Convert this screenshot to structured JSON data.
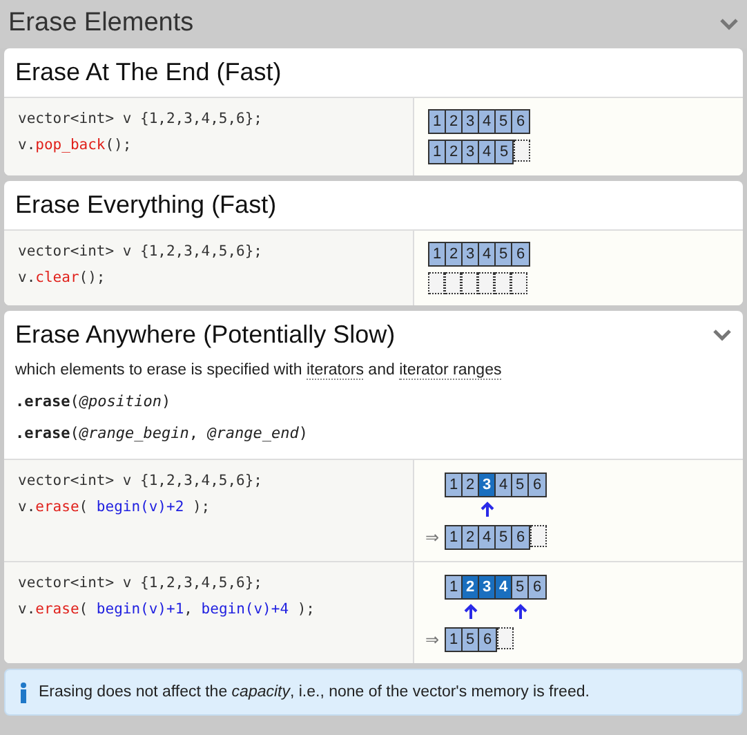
{
  "header": {
    "title": "Erase Elements",
    "chevron": true
  },
  "sections": [
    {
      "title": "Erase At The End (Fast)",
      "chevron": false,
      "examples": [
        {
          "code": [
            [
              {
                "text": "vector<int> v {1,2,3,4,5,6};",
                "kind": "plain"
              }
            ],
            [
              {
                "text": "v.",
                "kind": "plain"
              },
              {
                "text": "pop_back",
                "kind": "method"
              },
              {
                "text": "();",
                "kind": "plain"
              }
            ]
          ],
          "diagram": [
            {
              "kind": "vector",
              "cells": [
                {
                  "text": "1",
                  "kind": "filled"
                },
                {
                  "text": "2",
                  "kind": "filled"
                },
                {
                  "text": "3",
                  "kind": "filled"
                },
                {
                  "text": "4",
                  "kind": "filled"
                },
                {
                  "text": "5",
                  "kind": "filled"
                },
                {
                  "text": "6",
                  "kind": "filled"
                }
              ]
            },
            {
              "kind": "vector",
              "cells": [
                {
                  "text": "1",
                  "kind": "filled"
                },
                {
                  "text": "2",
                  "kind": "filled"
                },
                {
                  "text": "3",
                  "kind": "filled"
                },
                {
                  "text": "4",
                  "kind": "filled"
                },
                {
                  "text": "5",
                  "kind": "filled"
                },
                {
                  "kind": "empty"
                }
              ]
            }
          ]
        }
      ]
    },
    {
      "title": "Erase Everything (Fast)",
      "chevron": false,
      "examples": [
        {
          "code": [
            [
              {
                "text": "vector<int> v {1,2,3,4,5,6};",
                "kind": "plain"
              }
            ],
            [
              {
                "text": "v.",
                "kind": "plain"
              },
              {
                "text": "clear",
                "kind": "method"
              },
              {
                "text": "();",
                "kind": "plain"
              }
            ]
          ],
          "diagram": [
            {
              "kind": "vector",
              "cells": [
                {
                  "text": "1",
                  "kind": "filled"
                },
                {
                  "text": "2",
                  "kind": "filled"
                },
                {
                  "text": "3",
                  "kind": "filled"
                },
                {
                  "text": "4",
                  "kind": "filled"
                },
                {
                  "text": "5",
                  "kind": "filled"
                },
                {
                  "text": "6",
                  "kind": "filled"
                }
              ]
            },
            {
              "kind": "vector",
              "cells": [
                {
                  "kind": "empty"
                },
                {
                  "kind": "empty"
                },
                {
                  "kind": "empty"
                },
                {
                  "kind": "empty"
                },
                {
                  "kind": "empty"
                },
                {
                  "kind": "empty"
                }
              ]
            }
          ]
        }
      ]
    },
    {
      "title": "Erase Anywhere (Potentially Slow)",
      "chevron": true,
      "intro": [
        {
          "text": "which elements to erase is specified with ",
          "kind": "plain"
        },
        {
          "text": "iterators",
          "kind": "link"
        },
        {
          "text": " and ",
          "kind": "plain"
        },
        {
          "text": "iterator ranges",
          "kind": "link"
        }
      ],
      "signatures": [
        "**.erase**(*@position*)",
        "**.erase**(*@range_begin*, *@range_end*)"
      ],
      "examples": [
        {
          "code": [
            [
              {
                "text": "vector<int> v {1,2,3,4,5,6};",
                "kind": "plain"
              }
            ],
            [
              {
                "text": "v.",
                "kind": "plain"
              },
              {
                "text": "erase",
                "kind": "method"
              },
              {
                "text": "( ",
                "kind": "plain"
              },
              {
                "text": "begin(v)+2",
                "kind": "iterator"
              },
              {
                "text": " );",
                "kind": "plain"
              }
            ]
          ],
          "diagram": [
            {
              "kind": "vector",
              "cells": [
                {
                  "text": "1",
                  "kind": "filled"
                },
                {
                  "text": "2",
                  "kind": "filled"
                },
                {
                  "text": "3",
                  "kind": "highlighted"
                },
                {
                  "text": "4",
                  "kind": "filled"
                },
                {
                  "text": "5",
                  "kind": "filled"
                },
                {
                  "text": "6",
                  "kind": "filled"
                }
              ]
            },
            {
              "kind": "pointers",
              "cells": [
                {
                  "kind": "blank"
                },
                {
                  "kind": "blank"
                },
                {
                  "kind": "arrow"
                },
                {
                  "kind": "blank"
                },
                {
                  "kind": "blank"
                },
                {
                  "kind": "blank"
                }
              ]
            },
            {
              "kind": "vector",
              "prefix": "⇒",
              "cells": [
                {
                  "text": "1",
                  "kind": "filled"
                },
                {
                  "text": "2",
                  "kind": "filled"
                },
                {
                  "text": "4",
                  "kind": "filled"
                },
                {
                  "text": "5",
                  "kind": "filled"
                },
                {
                  "text": "6",
                  "kind": "filled"
                },
                {
                  "kind": "empty"
                }
              ]
            }
          ]
        },
        {
          "code": [
            [
              {
                "text": "vector<int> v {1,2,3,4,5,6};",
                "kind": "plain"
              }
            ],
            [
              {
                "text": "v.",
                "kind": "plain"
              },
              {
                "text": "erase",
                "kind": "method"
              },
              {
                "text": "( ",
                "kind": "plain"
              },
              {
                "text": "begin(v)+1",
                "kind": "iterator"
              },
              {
                "text": ", ",
                "kind": "plain"
              },
              {
                "text": "begin(v)+4",
                "kind": "iterator"
              },
              {
                "text": " );",
                "kind": "plain"
              }
            ]
          ],
          "diagram": [
            {
              "kind": "vector",
              "cells": [
                {
                  "text": "1",
                  "kind": "filled"
                },
                {
                  "text": "2",
                  "kind": "highlighted"
                },
                {
                  "text": "3",
                  "kind": "highlighted"
                },
                {
                  "text": "4",
                  "kind": "highlighted"
                },
                {
                  "text": "5",
                  "kind": "filled"
                },
                {
                  "text": "6",
                  "kind": "filled"
                }
              ]
            },
            {
              "kind": "pointers",
              "cells": [
                {
                  "kind": "blank"
                },
                {
                  "kind": "arrow"
                },
                {
                  "kind": "blank"
                },
                {
                  "kind": "blank"
                },
                {
                  "kind": "arrow"
                },
                {
                  "kind": "blank"
                }
              ]
            },
            {
              "kind": "vector",
              "prefix": "⇒",
              "cells": [
                {
                  "text": "1",
                  "kind": "filled"
                },
                {
                  "text": "5",
                  "kind": "filled"
                },
                {
                  "text": "6",
                  "kind": "filled"
                },
                {
                  "kind": "empty"
                }
              ]
            }
          ]
        }
      ]
    }
  ],
  "note": {
    "text": "Erasing does not affect the *capacity*, i.e., none of the vector's memory is freed."
  }
}
